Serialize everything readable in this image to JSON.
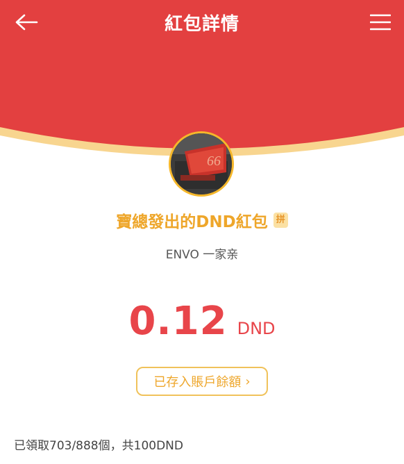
{
  "header": {
    "title": "紅包詳情",
    "back_icon": "arrow-left-icon",
    "menu_icon": "hamburger-menu-icon"
  },
  "packet": {
    "sender_title": "寶總發出的DND紅包",
    "badge": "拼",
    "group_name": "ENVO 一家亲",
    "amount": "0.12",
    "unit": "DND",
    "deposit_label": "已存入賬戶餘額",
    "deposit_chevron": "›"
  },
  "summary": {
    "text": "已領取703/888個，共100DND"
  },
  "colors": {
    "header_red": "#e34040",
    "gold_stripe": "#f8d58f",
    "accent_gold": "#eea62a",
    "amount_red": "#e8454a"
  }
}
